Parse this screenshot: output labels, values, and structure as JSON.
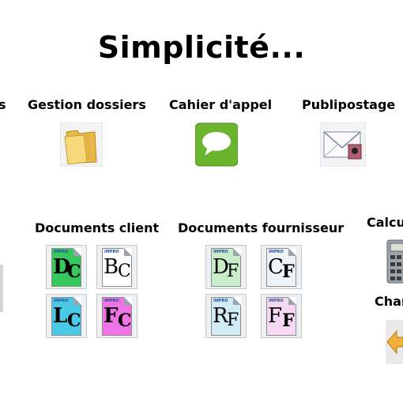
{
  "title": "Simplicité...",
  "sections": {
    "left_cut": "s",
    "gestion": "Gestion dossiers",
    "cahier": "Cahier d'appel",
    "publipostage": "Publipostage",
    "docs_client": "Documents client",
    "docs_fournisseur": "Documents fournisseur",
    "calc_cut": "Calcu",
    "char_cut": "Char"
  },
  "docs": {
    "dc": [
      "D",
      "C"
    ],
    "bc": [
      "B",
      "C"
    ],
    "lc": [
      "L",
      "C"
    ],
    "fc": [
      "F",
      "C"
    ],
    "df": [
      "D",
      "F"
    ],
    "cf": [
      "C",
      "F"
    ],
    "rf": [
      "R",
      "F"
    ],
    "ff": [
      "F",
      "F"
    ]
  }
}
